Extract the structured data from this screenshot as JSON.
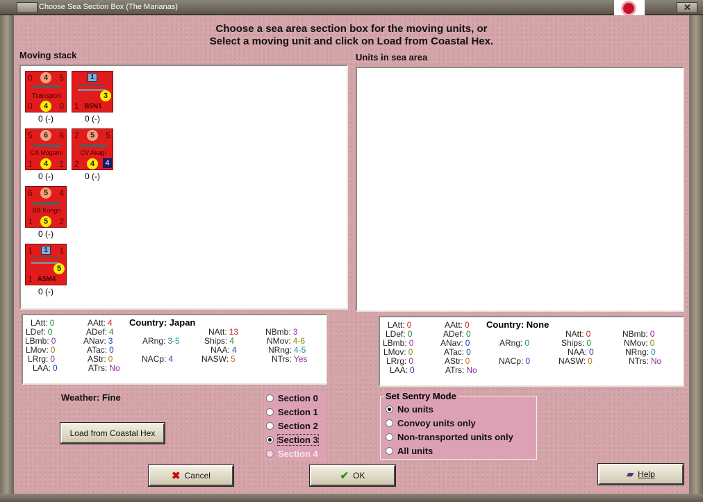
{
  "window": {
    "title": "Choose Sea Section Box (The Marianas)"
  },
  "heading": {
    "line1": "Choose a sea area section box for the moving units, or",
    "line2": "Select a moving unit and click on Load from Coastal Hex."
  },
  "moving_stack": {
    "label": "Moving stack",
    "units": [
      {
        "name": "Transport",
        "top_l": "0",
        "top_m": "4",
        "top_r": "5",
        "bot_l": "0",
        "bot_m": "4",
        "bot_r": "0",
        "value": "0 (-)"
      },
      {
        "name": "B5N1",
        "badge": "1",
        "mid": "3",
        "bot_l": "1",
        "value": "0 (-)"
      },
      {
        "name": "CA Mogami",
        "top_l": "5",
        "top_m": "6",
        "top_r": "6",
        "bot_l": "1",
        "bot_m": "4",
        "bot_r": "1",
        "value": "0 (-)"
      },
      {
        "name": "CV Akagi",
        "top_l": "2",
        "top_m": "5",
        "top_r": "5",
        "bot_l": "2",
        "bot_m": "4",
        "bot_r": "4",
        "value": "0 (-)"
      },
      {
        "name": "BB Kongo",
        "top_l": "6",
        "top_m": "5",
        "top_r": "4",
        "bot_l": "1",
        "bot_m": "5",
        "bot_r": "2",
        "value": "0 (-)"
      },
      {
        "name": "A5M4",
        "badge": "1",
        "mid": "5",
        "top_l": "1",
        "top_r": "1",
        "bot_l": "1",
        "value": "0 (-)"
      }
    ]
  },
  "sea_area": {
    "label": "Units in sea area"
  },
  "left_stats": {
    "country_label": "Country:",
    "country": "Japan",
    "LAtt": "0",
    "LDef": "0",
    "LBmb": "0",
    "LMov": "0",
    "LRrg": "0",
    "LAA": "0",
    "AAtt": "4",
    "ADef": "4",
    "ANav": "3",
    "ATac": "0",
    "AStr": "0",
    "ATrs": "No",
    "ARng": "3-5",
    "NACp": "4",
    "NAtt": "13",
    "Ships": "4",
    "NAA": "4",
    "NASW": "5",
    "NBmb": "3",
    "NMov": "4-6",
    "NRng": "4-5",
    "NTrs": "Yes"
  },
  "right_stats": {
    "country_label": "Country:",
    "country": "None",
    "LAtt": "0",
    "LDef": "0",
    "LBmb": "0",
    "LMov": "0",
    "LRrg": "0",
    "LAA": "0",
    "AAtt": "0",
    "ADef": "0",
    "ANav": "0",
    "ATac": "0",
    "AStr": "0",
    "ATrs": "No",
    "ARng": "0",
    "NACp": "0",
    "NAtt": "0",
    "Ships": "0",
    "NAA": "0",
    "NASW": "0",
    "NBmb": "0",
    "NMov": "0",
    "NRng": "0",
    "NTrs": "No"
  },
  "weather": "Weather: Fine",
  "sections": [
    {
      "label": "Section 0",
      "checked": false,
      "disabled": false
    },
    {
      "label": "Section 1",
      "checked": false,
      "disabled": false
    },
    {
      "label": "Section 2",
      "checked": false,
      "disabled": false
    },
    {
      "label": "Section 3",
      "checked": true,
      "disabled": false
    },
    {
      "label": "Section 4",
      "checked": false,
      "disabled": true
    }
  ],
  "sentry": {
    "title": "Set Sentry Mode",
    "options": [
      "No units",
      "Convoy units only",
      "Non-transported units only",
      "All units"
    ],
    "selected": 0
  },
  "buttons": {
    "load": "Load from Coastal Hex",
    "cancel": "Cancel",
    "ok": "OK",
    "help": "Help"
  }
}
